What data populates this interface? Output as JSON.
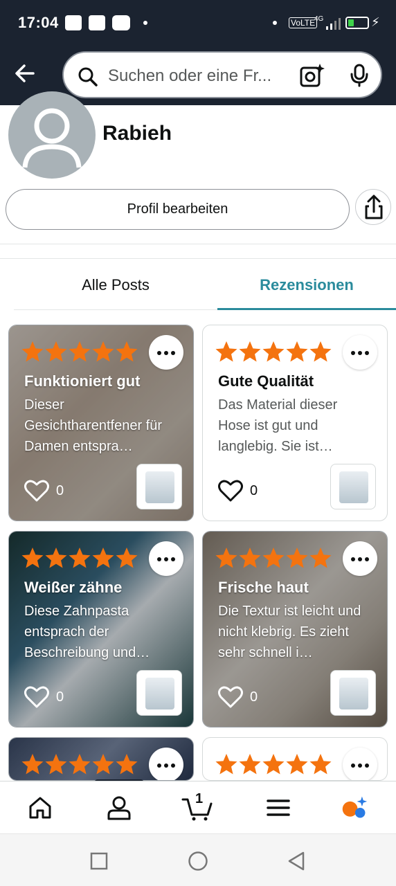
{
  "status_bar": {
    "time": "17:04",
    "volte": "VoLTE",
    "network": "4G"
  },
  "search": {
    "placeholder": "Suchen oder eine Fr..."
  },
  "profile": {
    "name": "Rabieh",
    "edit_label": "Profil bearbeiten"
  },
  "tabs": [
    {
      "label": "Alle Posts",
      "active": false
    },
    {
      "label": "Rezensionen",
      "active": true
    }
  ],
  "reviews": [
    {
      "title": "Funktioniert gut",
      "body": "Dieser Gesichtharentfener für Damen entspra…",
      "likes": "0",
      "rating": 5,
      "has_photo": true
    },
    {
      "title": "Gute Qualität",
      "body": "Das Material dieser Hose ist gut und langlebig. Sie ist…",
      "likes": "0",
      "rating": 5,
      "has_photo": false
    },
    {
      "title": "Weißer zähne",
      "body": "Diese Zahnpasta entsprach der Beschreibung und…",
      "likes": "0",
      "rating": 5,
      "has_photo": true
    },
    {
      "title": "Frische haut",
      "body": "Die Textur ist leicht und nicht klebrig. Es zieht sehr schnell i…",
      "likes": "0",
      "rating": 5,
      "has_photo": true
    },
    {
      "rating": 5,
      "has_photo": true
    },
    {
      "rating": 5,
      "has_photo": false
    }
  ],
  "bottom_nav": {
    "cart_count": "1",
    "items": [
      "home-icon",
      "profile-icon",
      "cart-icon",
      "menu-icon",
      "rufus-icon"
    ]
  },
  "colors": {
    "header_bg": "#1b2330",
    "star": "#f4730f",
    "accent_tab": "#2a8b9c"
  }
}
